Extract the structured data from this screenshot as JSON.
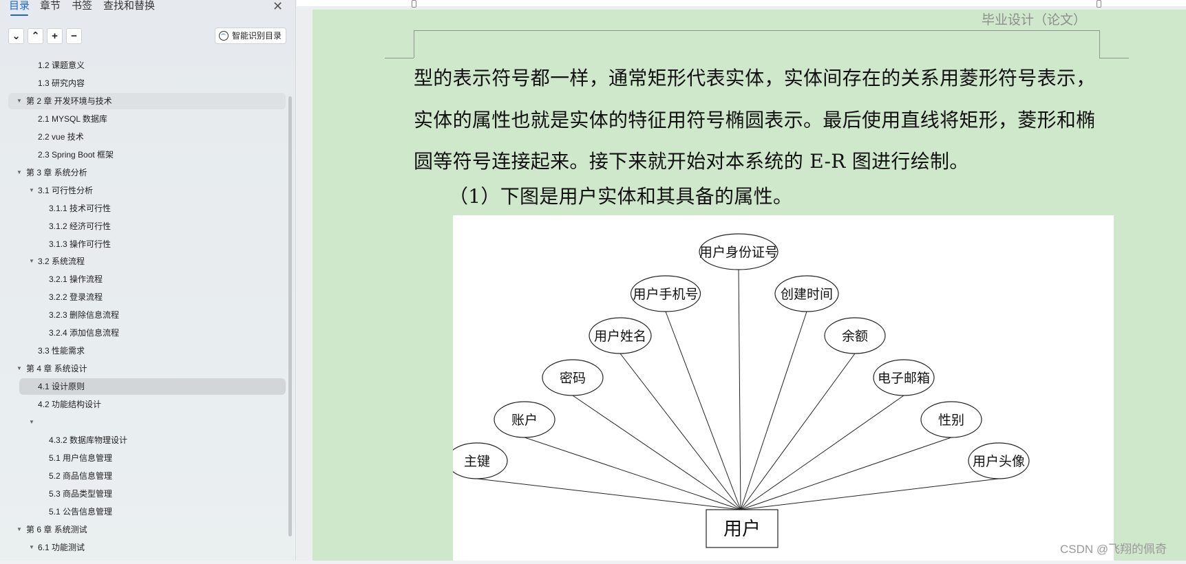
{
  "sidebar": {
    "tabs": [
      "目录",
      "章节",
      "书签",
      "查找和替换"
    ],
    "active_tab": "目录",
    "toolbar": {
      "collapse": "⌄",
      "expand": "⌃",
      "add": "+",
      "remove": "−",
      "smart_label": "智能识别目录"
    },
    "items": [
      {
        "label": "1.2  课题意义",
        "level": 2
      },
      {
        "label": "1.3  研究内容",
        "level": 2
      },
      {
        "label": "第 2 章  开发环境与技术",
        "level": 1,
        "expanded": true,
        "highlight": "hover"
      },
      {
        "label": "2.1 MYSQL 数据库",
        "level": 2
      },
      {
        "label": "2.2 vue 技术",
        "level": 2
      },
      {
        "label": "2.3 Spring Boot 框架",
        "level": 2
      },
      {
        "label": "第 3 章  系统分析",
        "level": 1,
        "expanded": true
      },
      {
        "label": "3.1  可行性分析",
        "level": 2,
        "expanded": true
      },
      {
        "label": "3.1.1  技术可行性",
        "level": 3
      },
      {
        "label": "3.1.2  经济可行性",
        "level": 3
      },
      {
        "label": "3.1.3  操作可行性",
        "level": 3
      },
      {
        "label": "3.2  系统流程",
        "level": 2,
        "expanded": true
      },
      {
        "label": "3.2.1  操作流程",
        "level": 3
      },
      {
        "label": "3.2.2  登录流程",
        "level": 3
      },
      {
        "label": "3.2.3  删除信息流程",
        "level": 3
      },
      {
        "label": "3.2.4  添加信息流程",
        "level": 3
      },
      {
        "label": "3.3  性能需求",
        "level": 2
      },
      {
        "label": "第 4 章  系统设计",
        "level": 1,
        "expanded": true
      },
      {
        "label": "4.1  设计原则",
        "level": 2,
        "highlight": "selected"
      },
      {
        "label": "4.2  功能结构设计",
        "level": 2
      },
      {
        "label": "",
        "level": 2,
        "expanded": true
      },
      {
        "label": "4.3.2  数据库物理设计",
        "level": 3
      },
      {
        "label": "5.1 用户信息管理",
        "level": 3
      },
      {
        "label": "5.2  商品信息管理",
        "level": 3
      },
      {
        "label": "5.3 商品类型管理",
        "level": 3
      },
      {
        "label": "5.1 公告信息管理",
        "level": 3
      },
      {
        "label": "第 6 章  系统测试",
        "level": 1,
        "expanded": true
      },
      {
        "label": "6.1  功能测试",
        "level": 2,
        "expanded": true
      }
    ]
  },
  "document": {
    "header": "毕业设计（论文）",
    "lines": [
      "型的表示符号都一样，通常矩形代表实体，实体间存在的关系用菱形符号表示，",
      "实体的属性也就是实体的特征用符号椭圆表示。最后使用直线将矩形，菱形和椭",
      "圆等符号连接起来。接下来就开始对本系统的 E-R 图进行绘制。",
      "（1）下图是用户实体和其具备的属性。"
    ],
    "diagram": {
      "entity": "用户",
      "attributes": [
        "主键",
        "账户",
        "密码",
        "用户姓名",
        "用户手机号",
        "用户身份证号",
        "创建时间",
        "余额",
        "电子邮箱",
        "性别",
        "用户头像"
      ]
    },
    "watermark": "CSDN @飞翔的佩奇"
  },
  "colors": {
    "accent": "#1f66d1",
    "page_bg": "#cfe7cb"
  }
}
